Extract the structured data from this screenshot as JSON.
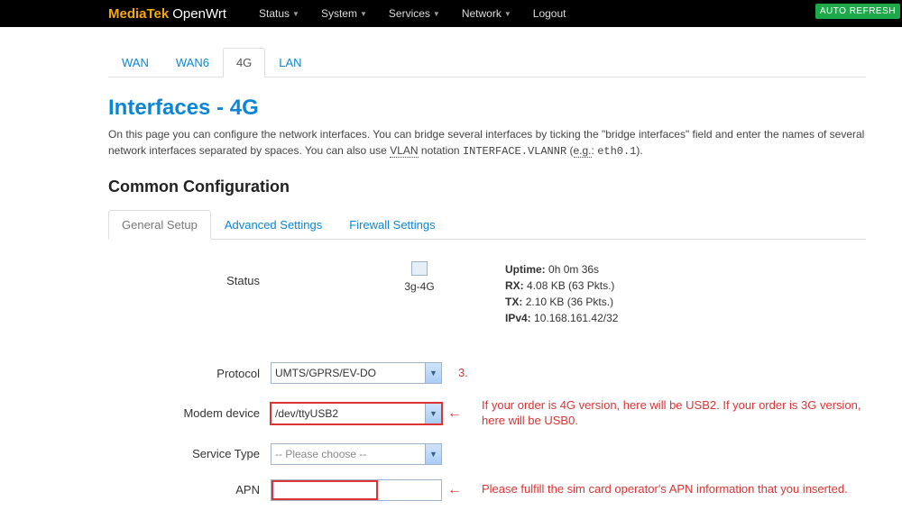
{
  "brand": {
    "prefix": "MediaTek",
    "suffix": "OpenWrt"
  },
  "nav": {
    "items": [
      "Status",
      "System",
      "Services",
      "Network",
      "Logout"
    ],
    "refresh_btn": "AUTO REFRESH"
  },
  "iface_tabs": [
    "WAN",
    "WAN6",
    "4G",
    "LAN"
  ],
  "page": {
    "heading": "Interfaces - 4G",
    "desc_a": "On this page you can configure the network interfaces. You can bridge several interfaces by ticking the \"bridge interfaces\" field and enter the names of several network interfaces separated by spaces. You can also use ",
    "vlan_abbr": "VLAN",
    "desc_b": " notation ",
    "vlan_example_code": "INTERFACE.VLANNR",
    "desc_c": " (",
    "eg": "e.g.",
    "desc_d": ": ",
    "eth_example": "eth0.1",
    "desc_e": ")."
  },
  "section_heading": "Common Configuration",
  "conf_tabs": [
    "General Setup",
    "Advanced Settings",
    "Firewall Settings"
  ],
  "status": {
    "label": "Status",
    "iface_name": "3g-4G",
    "uptime_label": "Uptime:",
    "uptime_val": "0h 0m 36s",
    "rx_label": "RX:",
    "rx_val": "4.08 KB (63 Pkts.)",
    "tx_label": "TX:",
    "tx_val": "2.10 KB (36 Pkts.)",
    "ipv4_label": "IPv4:",
    "ipv4_val": "10.168.161.42/32"
  },
  "form": {
    "protocol_label": "Protocol",
    "protocol_value": "UMTS/GPRS/EV-DO",
    "modem_label": "Modem device",
    "modem_value": "/dev/ttyUSB2",
    "service_label": "Service Type",
    "service_placeholder": "-- Please choose --",
    "apn_label": "APN"
  },
  "annotations": {
    "step_number": "3.",
    "modem_note": "If your order is 4G version, here will be USB2. If your order is 3G version, here will be USB0.",
    "apn_note": "Please fulfill the sim card operator's APN information that you inserted.",
    "arrow": "←"
  }
}
